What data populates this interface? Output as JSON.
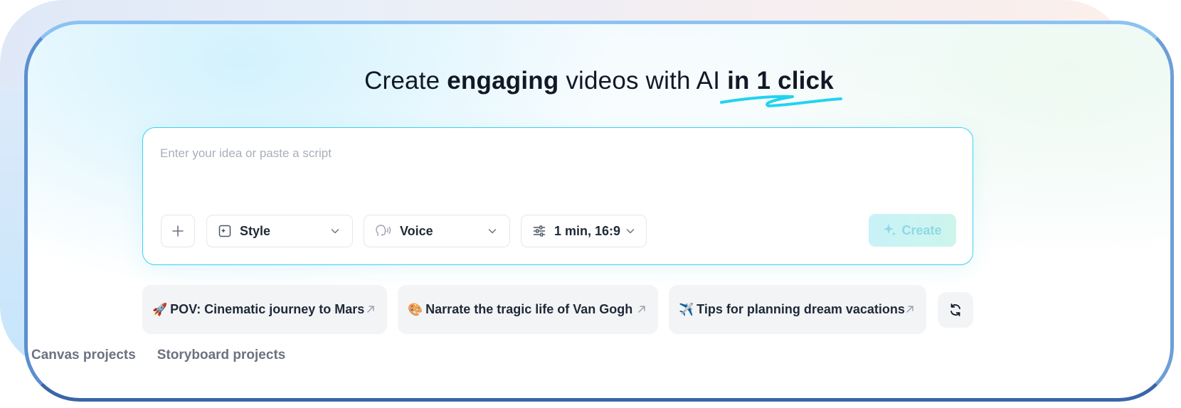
{
  "headline": {
    "part1": "Create ",
    "bold1": "engaging",
    "part2": " videos with AI ",
    "bold2": "in 1 click"
  },
  "prompt": {
    "placeholder": "Enter your idea or paste a script",
    "value": ""
  },
  "controls": {
    "add_icon": "plus-icon",
    "style_label": "Style",
    "style_icon": "style-frame-icon",
    "voice_label": "Voice",
    "voice_icon": "voice-head-icon",
    "duration_label": "1 min, 16:9",
    "duration_icon": "sliders-icon",
    "create_label": "Create",
    "create_icon": "sparkle-icon"
  },
  "suggestions": [
    {
      "emoji": "🚀",
      "label": "POV: Cinematic journey to Mars"
    },
    {
      "emoji": "🎨",
      "label": "Narrate the tragic life of Van Gogh"
    },
    {
      "emoji": "✈️",
      "label": "Tips for planning dream vacations"
    }
  ],
  "tabs": [
    "Canvas projects",
    "Storyboard projects"
  ],
  "colors": {
    "accent_cyan": "#38d3ee",
    "create_button_bg": "#c9f2f8",
    "create_button_text": "#8fd9e5",
    "frame_border": "#7aa8e0",
    "chip_bg": "#f3f4f6"
  }
}
